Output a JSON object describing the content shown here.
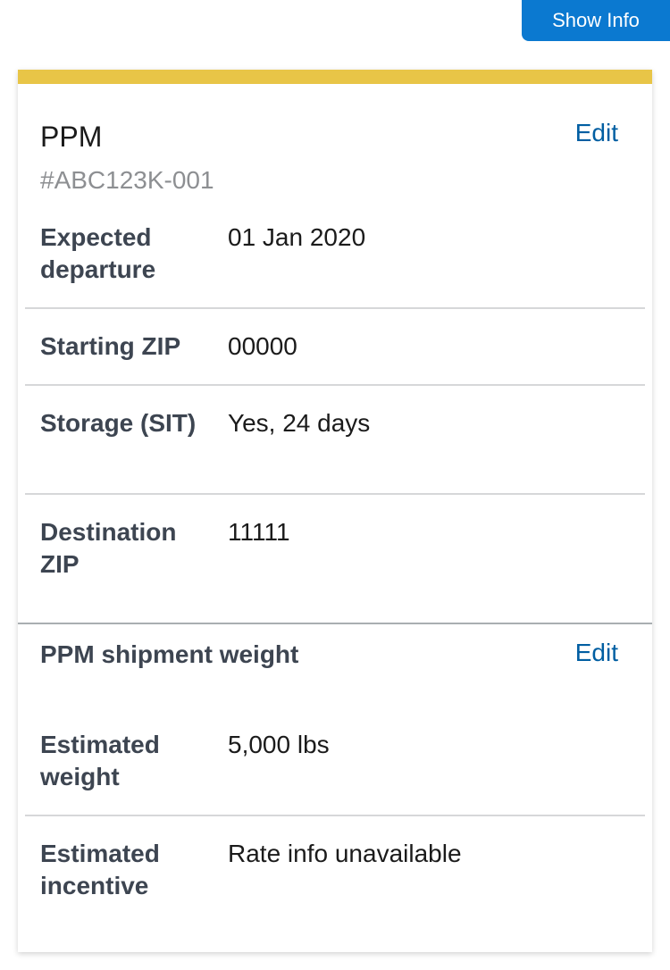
{
  "header": {
    "show_info_label": "Show Info"
  },
  "colors": {
    "accent_bar": "#e8c547",
    "button_bg": "#0b79d0",
    "link": "#005ea2"
  },
  "shipment": {
    "title": "PPM",
    "id": "#ABC123K-001",
    "edit_label": "Edit",
    "rows": [
      {
        "label": "Expected departure",
        "value": "01 Jan 2020"
      },
      {
        "label": "Starting ZIP",
        "value": "00000"
      },
      {
        "label": "Storage (SIT)",
        "value": "Yes, 24 days"
      },
      {
        "label": "Destination ZIP",
        "value": "11111"
      }
    ]
  },
  "weight_section": {
    "title": "PPM shipment weight",
    "edit_label": "Edit",
    "rows": [
      {
        "label": "Estimated weight",
        "value": "5,000 lbs"
      },
      {
        "label": "Estimated incentive",
        "value": "Rate info unavailable"
      }
    ]
  }
}
